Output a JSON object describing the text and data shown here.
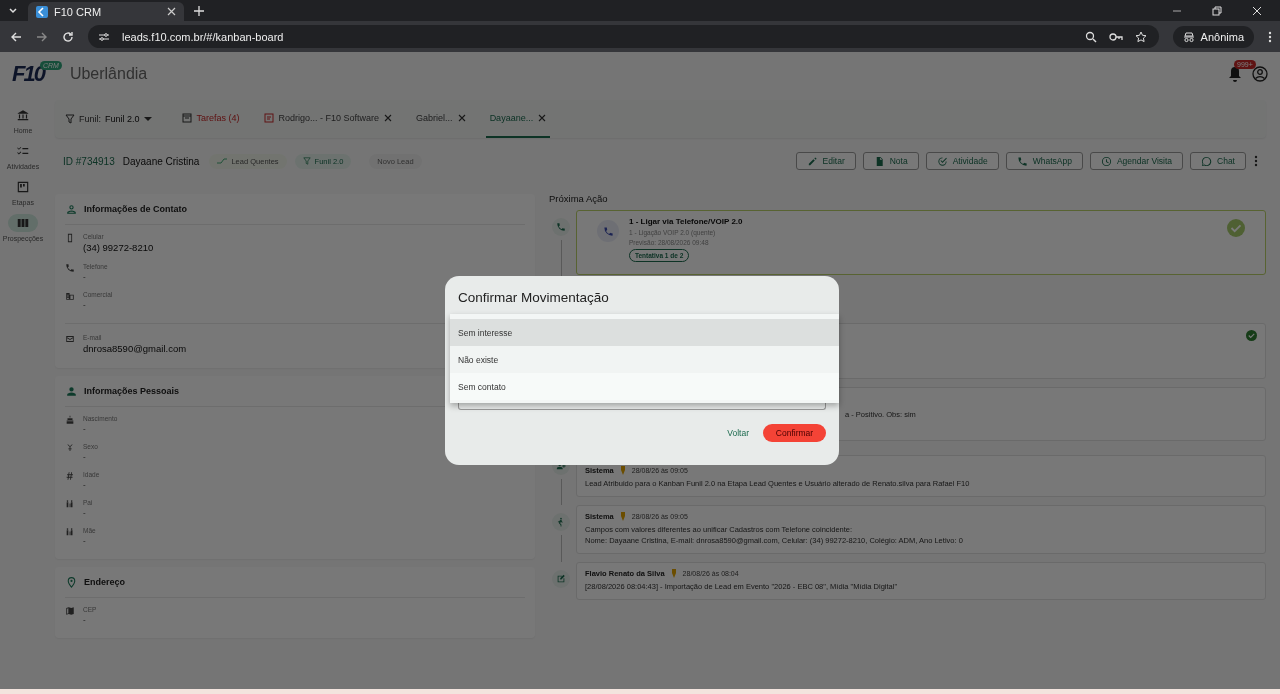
{
  "browser": {
    "tab_title": "F10 CRM",
    "url": "leads.f10.com.br/#/kanban-board",
    "profile": "Anônima"
  },
  "header": {
    "logo": "F10",
    "logo_badge": "CRM",
    "city": "Uberlândia",
    "notifications": "999+"
  },
  "sidebar": [
    {
      "label": "Home",
      "selected": false
    },
    {
      "label": "Atividades",
      "selected": false
    },
    {
      "label": "Etapas",
      "selected": false
    },
    {
      "label": "Prospecções",
      "selected": true
    }
  ],
  "funnel": {
    "label": "Funil:",
    "value": "Funil 2.0"
  },
  "tabs": [
    {
      "label": "Tarefas (4)",
      "kind": "tasks",
      "selected": false
    },
    {
      "label": "Rodrigo... - F10 Software",
      "kind": "flagged",
      "selected": false
    },
    {
      "label": "Gabriel...",
      "kind": "lead",
      "selected": false
    },
    {
      "label": "Dayaane...",
      "kind": "lead",
      "selected": true
    }
  ],
  "lead": {
    "id": "ID #734913",
    "name": "Dayaane Cristina",
    "tags": [
      {
        "label": "Lead Quentes",
        "kind": "stage"
      },
      {
        "label": "Funil 2.0",
        "kind": "funnel"
      },
      {
        "label": "Novo Lead",
        "kind": "plain"
      }
    ],
    "actions": [
      "Editar",
      "Nota",
      "Atividade",
      "WhatsApp",
      "Agendar Visita",
      "Chat"
    ]
  },
  "sections": [
    {
      "title": "Informações de Contato",
      "groups": [
        [
          {
            "label": "Celular",
            "value": "(34) 99272-8210",
            "kind": "filled"
          },
          {
            "label": "Telefone",
            "value": "-",
            "kind": "blank"
          },
          {
            "label": "Comercial",
            "value": "-",
            "kind": "blank"
          }
        ],
        [
          {
            "label": "E-mail",
            "value": "dnrosa8590@gmail.com",
            "kind": "filled"
          }
        ]
      ]
    },
    {
      "title": "Informações Pessoais",
      "groups": [
        [
          {
            "label": "Nascimento",
            "value": "-",
            "kind": "blank"
          },
          {
            "label": "Sexo",
            "value": "-",
            "kind": "blank"
          },
          {
            "label": "Idade",
            "value": "-",
            "kind": "blank"
          },
          {
            "label": "Pai",
            "value": "-",
            "kind": "blank"
          },
          {
            "label": "Mãe",
            "value": "-",
            "kind": "blank"
          }
        ]
      ]
    },
    {
      "title": "Endereço",
      "groups": [
        [
          {
            "label": "CEP",
            "value": "-",
            "kind": "blank"
          }
        ]
      ]
    }
  ],
  "next_action": {
    "title": "Próxima Ação",
    "entries": [
      {
        "kind": "action",
        "title": "1 - Ligar via Telefone/VOIP 2.0",
        "subtitle": "1 - Ligação VOIP 2.0 (quente)",
        "due": "Previsão: 28/08/2026 09:48",
        "chip": "Tentativa 1 de 2",
        "done": true
      },
      {
        "kind": "covered",
        "done": true
      },
      {
        "kind": "fragment",
        "text": "a - Positivo. Obs: sim",
        "done": false
      },
      {
        "kind": "note",
        "author": "Sistema",
        "date": "28/08/26 às 09:05",
        "text": "Lead Atribuido para o Kanban Funil 2.0 na Etapa Lead Quentes e Usuário alterado de Renato.silva para Rafael F10",
        "done": false
      },
      {
        "kind": "note",
        "author": "Sistema",
        "date": "28/08/26 às 09:05",
        "text": "Campos com valores diferentes ao unificar Cadastros com Telefone coincidente:\nNome: Dayaane Cristina, E-mail: dnrosa8590@gmail.com, Celular: (34) 99272-8210, Colégio: ADM, Ano Letivo: 0",
        "done": false
      },
      {
        "kind": "note",
        "author": "Flavio Renato da Silva",
        "date": "28/08/26 às 08:04",
        "text": "[28/08/2026 08:04:43] - Importação de Lead em Evento \"2026 - EBC 08\", Mídia \"Mídia Digital\"",
        "done": false
      }
    ]
  },
  "modal": {
    "title": "Confirmar Movimentação",
    "options": [
      {
        "label": "Sem interesse",
        "selected": true
      },
      {
        "label": "Não existe",
        "selected": false
      },
      {
        "label": "Sem contato",
        "selected": false
      }
    ],
    "cancel": "Voltar",
    "confirm": "Confirmar"
  }
}
